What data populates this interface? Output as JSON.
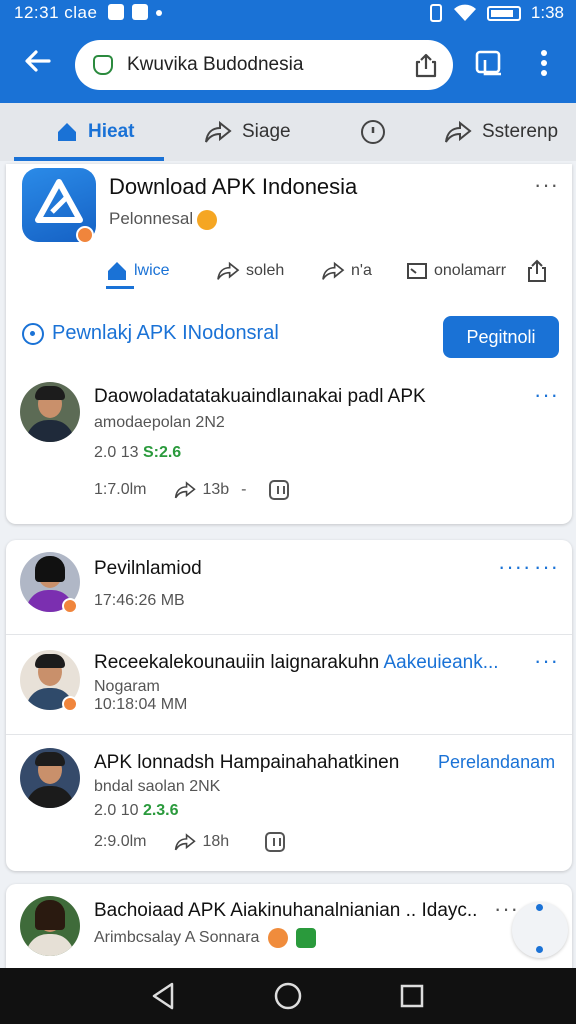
{
  "status": {
    "time": "12:31 clae",
    "clock_right": "1:38"
  },
  "browser": {
    "url": "Kwuvika Budodnesia"
  },
  "nav_tabs": [
    {
      "label": "Hieat",
      "icon": "home-icon"
    },
    {
      "label": "Siage",
      "icon": "share-icon"
    },
    {
      "label": "",
      "icon": "compass-icon"
    },
    {
      "label": "Ssterenp",
      "icon": "share-icon"
    }
  ],
  "page": {
    "title": "Download APK Indonesia",
    "subtitle": "Pelonnesal",
    "actions": [
      "lwice",
      "soleh",
      "n'a",
      "onolamarr",
      ""
    ],
    "section_link": "Pewnlakj APK INodonsral",
    "primary_button": "Pegitnoli"
  },
  "posts": [
    {
      "title": "Daowoladatatakuaindlaınakai padl APK",
      "sub": "amodaepolan 2N2",
      "meta_prefix": "2.0 13",
      "meta_highlight": "S:2.6",
      "stat1": "1:7.0lm",
      "stat2": "13b",
      "stat_sep": "-"
    },
    {
      "title": "Pevilnlamiod",
      "meta": "17:46:26 MB"
    },
    {
      "title": "Receekalekounauiin laignarakuhn",
      "title_link": "Aakeuieank...",
      "sub": "Nogaram",
      "meta": "10:18:04 MM"
    },
    {
      "title": "APK lonnadsh Hampainahahatkinen",
      "title_link": "Perelandanam",
      "sub": "bndal saolan 2NK",
      "meta_prefix": "2.0 10",
      "meta_highlight": "2.3.6",
      "stat1": "2:9.0lm",
      "stat2": "18h"
    },
    {
      "title": "Bachoiaad APK Aiakinuhanalnianian .. Idayc..",
      "sub": "Arimbcsalay A Sonnara"
    }
  ],
  "colors": {
    "accent": "#1a72d6",
    "highlight": "#2a9a3c",
    "badge": "#f0853c"
  }
}
